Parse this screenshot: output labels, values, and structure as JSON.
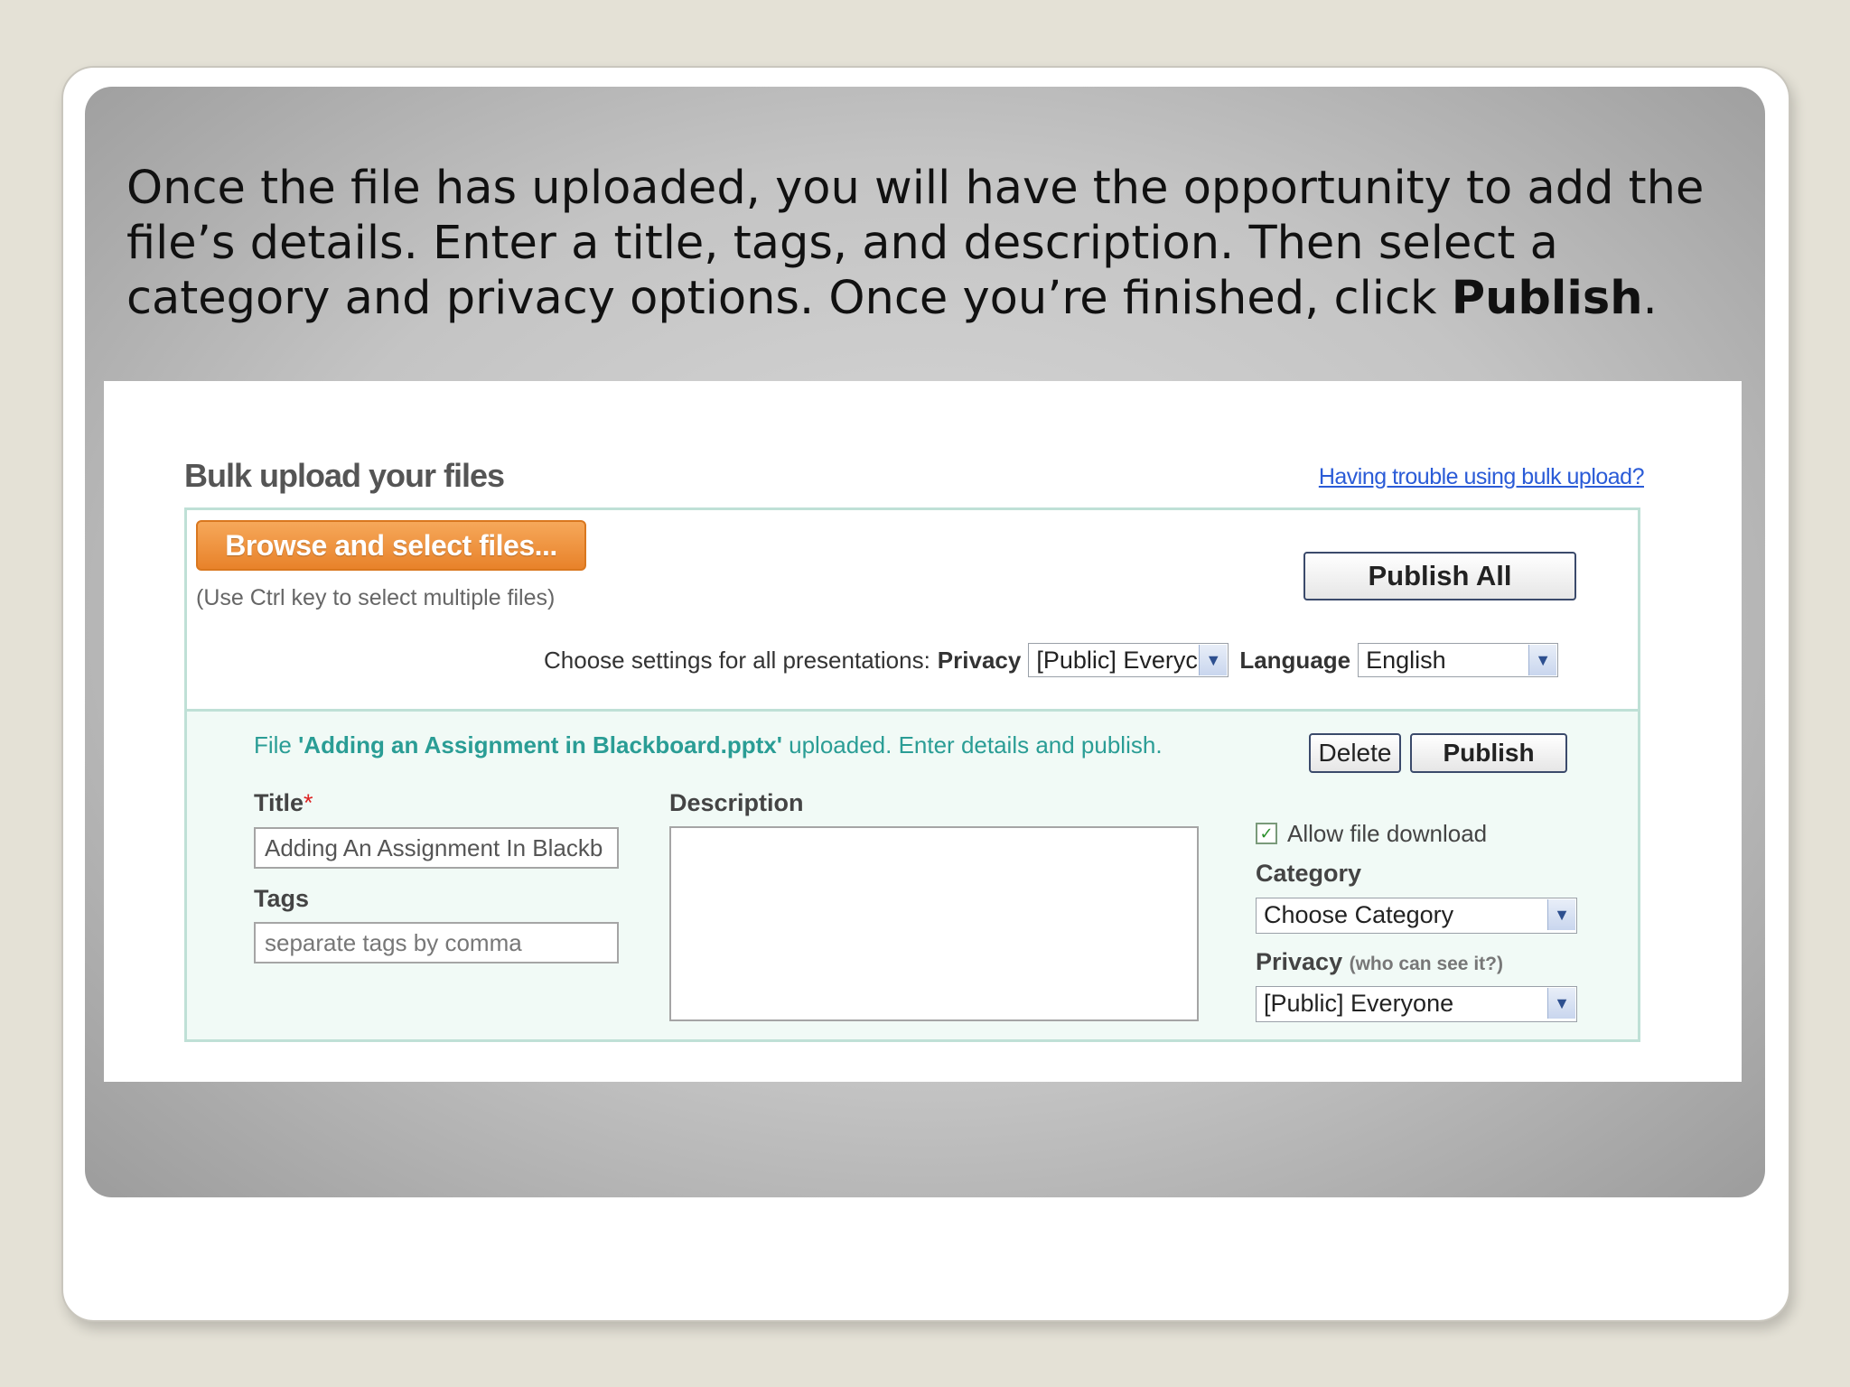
{
  "caption": {
    "text": "Once the file has uploaded, you will have the opportunity to add the file’s details.  Enter a title, tags, and description.  Then select a category and privacy options.  Once you’re finished, click ",
    "bold": "Publish",
    "end": "."
  },
  "bulk": {
    "title": "Bulk upload your files",
    "help_link": "Having trouble using bulk upload?",
    "browse_button": "Browse and select files...",
    "ctrl_note": "(Use Ctrl key to select multiple files)",
    "publish_all": "Publish All",
    "settings_label": "Choose settings for all presentations:",
    "privacy_label": "Privacy",
    "privacy_value": "[Public] Everyc",
    "language_label": "Language",
    "language_value": "English"
  },
  "file": {
    "msg_prefix": "File ",
    "filename": "'Adding an Assignment in Blackboard.pptx'",
    "msg_suffix": " uploaded. Enter details and publish.",
    "delete_button": "Delete",
    "publish_button": "Publish",
    "title_label": "Title",
    "title_required": "*",
    "title_value": "Adding An Assignment In Blackb",
    "tags_label": "Tags",
    "tags_placeholder": "separate tags by comma",
    "description_label": "Description",
    "allow_download_label": "Allow file download",
    "allow_download_checked": true,
    "category_label": "Category",
    "category_value": "Choose Category",
    "privacy_label": "Privacy",
    "privacy_hint": "(who can see it?)",
    "privacy_value": "[Public] Everyone"
  },
  "icons": {
    "dropdown": "chevron-down-icon",
    "checkmark": "checkmark-icon"
  }
}
